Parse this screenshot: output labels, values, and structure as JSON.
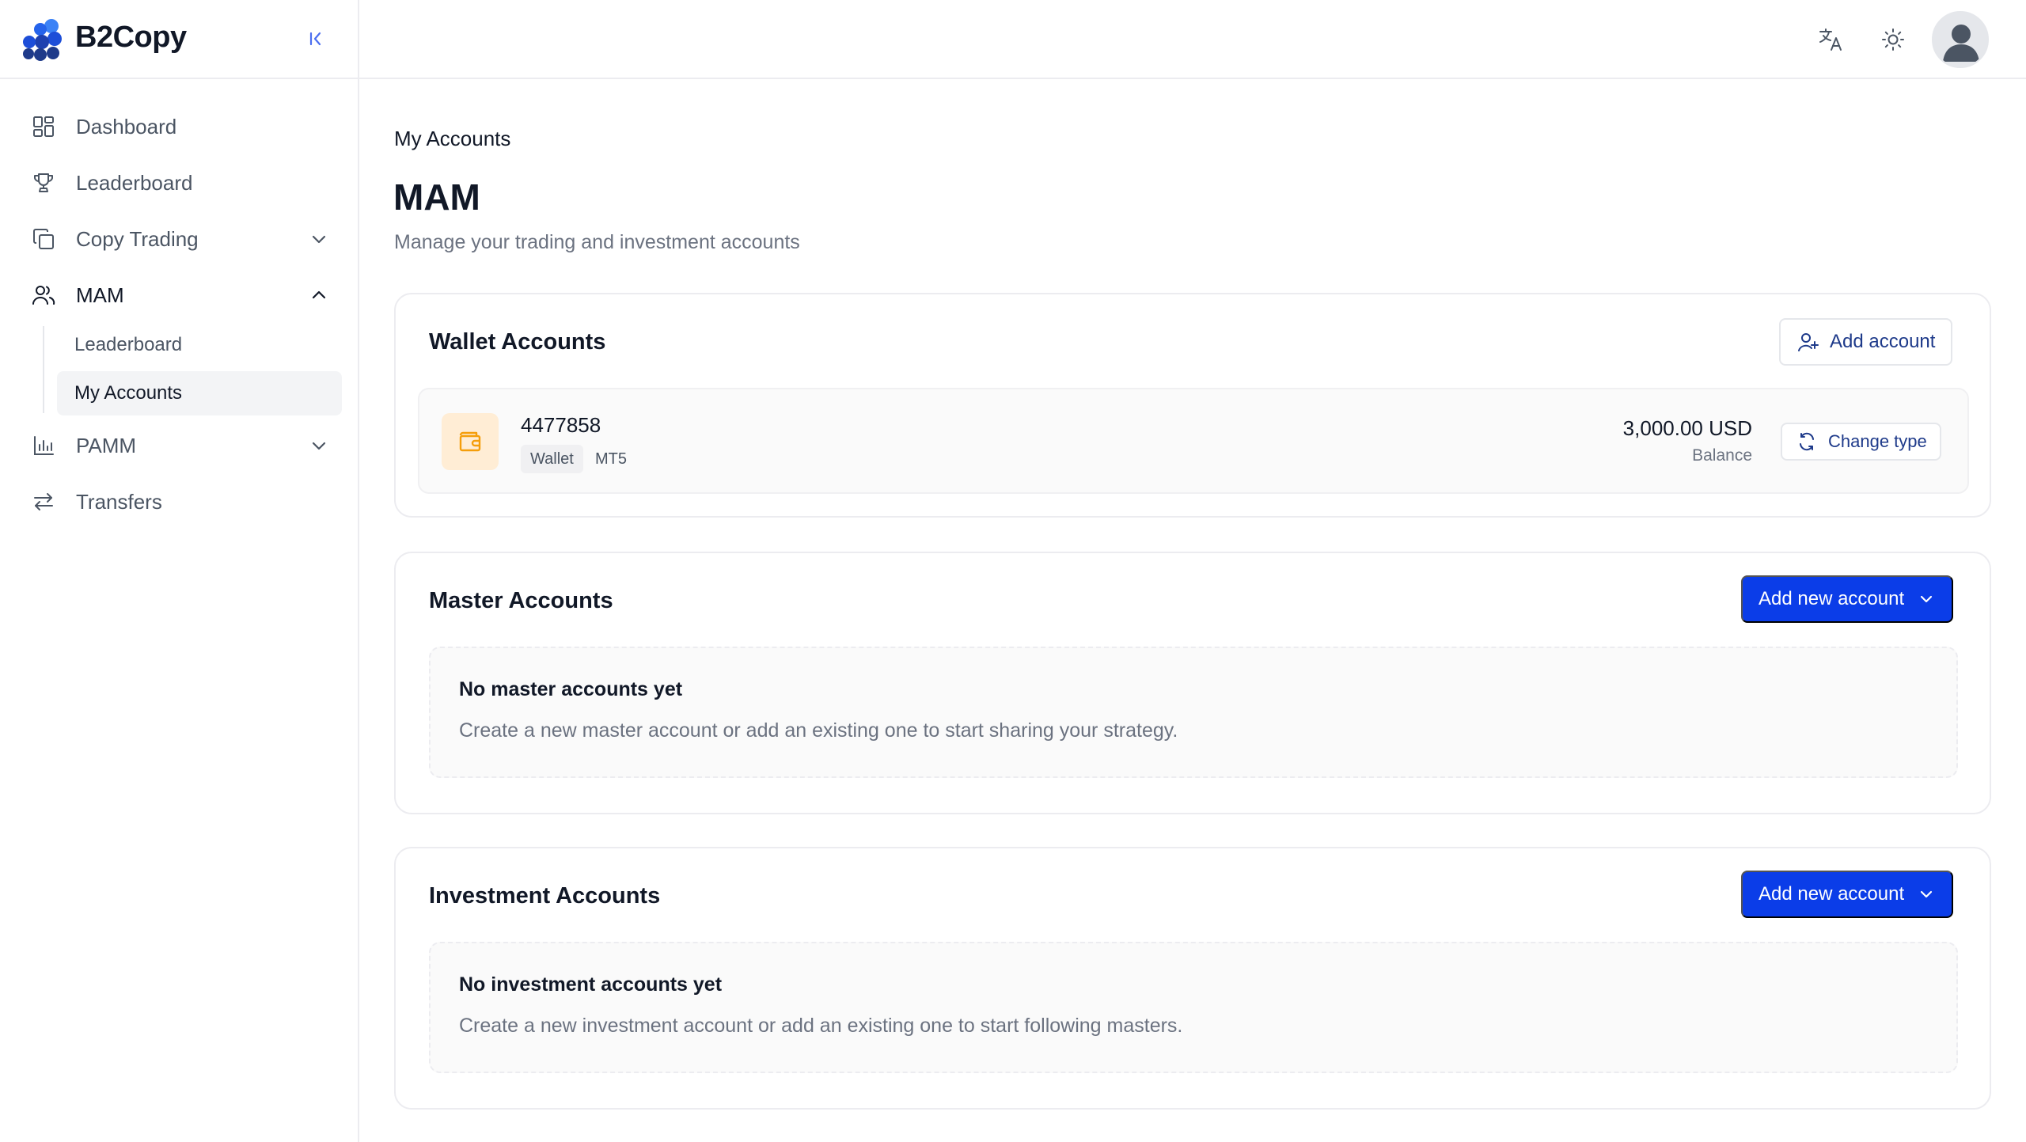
{
  "app": {
    "name": "B2Copy"
  },
  "sidebar": {
    "items": [
      {
        "label": "Dashboard",
        "icon": "dashboard-icon"
      },
      {
        "label": "Leaderboard",
        "icon": "trophy-icon"
      },
      {
        "label": "Copy Trading",
        "icon": "copy-icon",
        "expanded": false
      },
      {
        "label": "MAM",
        "icon": "users-icon",
        "expanded": true
      },
      {
        "label": "PAMM",
        "icon": "bar-chart-icon",
        "expanded": false
      },
      {
        "label": "Transfers",
        "icon": "transfer-icon"
      }
    ],
    "mam_sub": [
      {
        "label": "Leaderboard"
      },
      {
        "label": "My Accounts",
        "active": true
      }
    ]
  },
  "header": {
    "icons": [
      "translate-icon",
      "sun-icon",
      "avatar"
    ]
  },
  "page": {
    "breadcrumb": "My Accounts",
    "title": "MAM",
    "subtitle": "Manage your trading and investment accounts"
  },
  "wallet": {
    "title": "Wallet Accounts",
    "add_label": "Add account",
    "account": {
      "number": "4477858",
      "type": "Wallet",
      "platform": "MT5",
      "balance": "3,000.00 USD",
      "balance_label": "Balance",
      "change_label": "Change type"
    }
  },
  "master": {
    "title": "Master Accounts",
    "add_label": "Add new account",
    "empty_title": "No master accounts yet",
    "empty_desc": "Create a new master account or add an existing one to start sharing your strategy."
  },
  "investment": {
    "title": "Investment Accounts",
    "add_label": "Add new account",
    "empty_title": "No investment accounts yet",
    "empty_desc": "Create a new investment account or add an existing one to start following masters."
  },
  "colors": {
    "primary": "#0b3de8",
    "wallet_accent": "#f59e0b",
    "wallet_bg": "#ffedd5"
  }
}
